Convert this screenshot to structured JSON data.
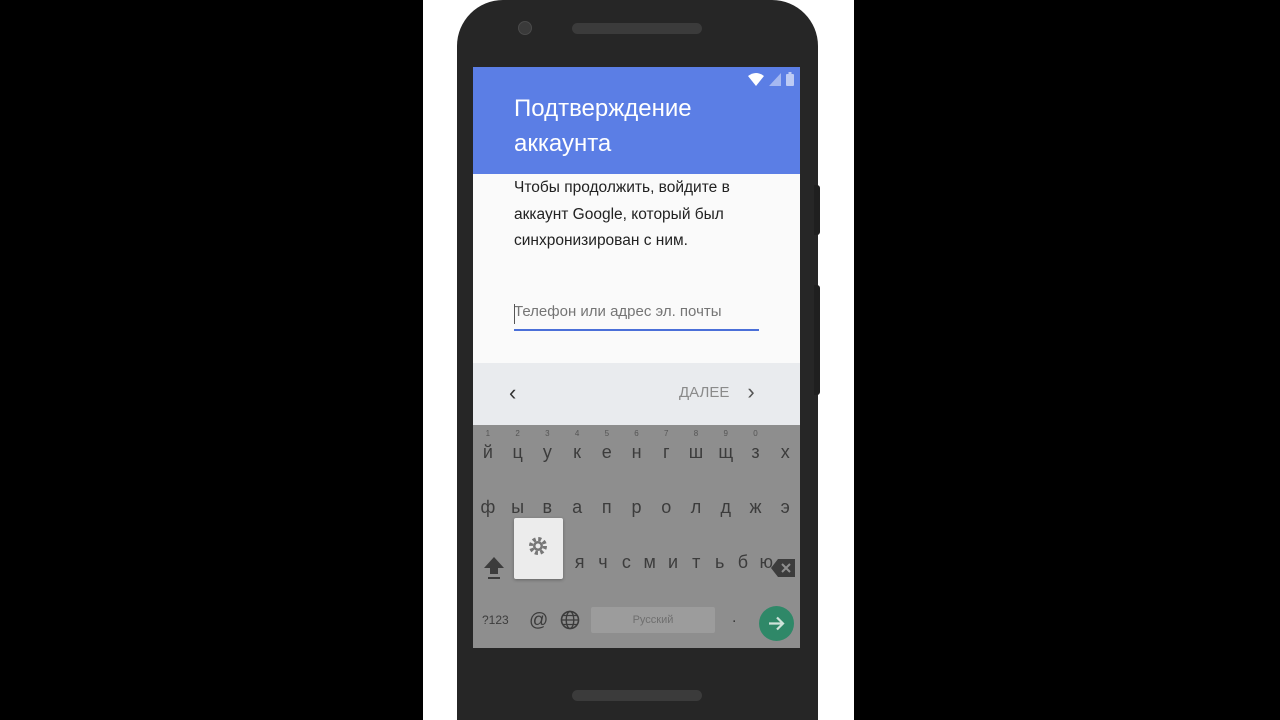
{
  "header": {
    "title_line1": "Подтверждение",
    "title_line2": "аккаунта"
  },
  "description": {
    "line1": "Чтобы продолжить, войдите в",
    "line2": "аккаунт Google, который был",
    "line3": "синхронизирован с ним."
  },
  "login_field": {
    "value": "",
    "placeholder": "Телефон или адрес эл. почты"
  },
  "navigation": {
    "back_symbol": "‹",
    "next_label": "ДАЛЕЕ",
    "next_symbol": "›"
  },
  "keyboard": {
    "row1": [
      "й",
      "ц",
      "у",
      "к",
      "е",
      "н",
      "г",
      "ш",
      "щ",
      "з",
      "х"
    ],
    "row1_hints": [
      "1",
      "2",
      "3",
      "4",
      "5",
      "6",
      "7",
      "8",
      "9",
      "0",
      ""
    ],
    "row2": [
      "ф",
      "ы",
      "в",
      "а",
      "п",
      "р",
      "о",
      "л",
      "д",
      "ж",
      "э"
    ],
    "row3": [
      "я",
      "ч",
      "с",
      "м",
      "и",
      "т",
      "ь",
      "б",
      "ю"
    ],
    "numbers_key": "?123",
    "at_key": "@",
    "space_label": "Русский",
    "period_key": "."
  },
  "colors": {
    "appbar": "#5b7ee5",
    "accent": "#4a6fd8",
    "enter_key": "#2f8868"
  }
}
